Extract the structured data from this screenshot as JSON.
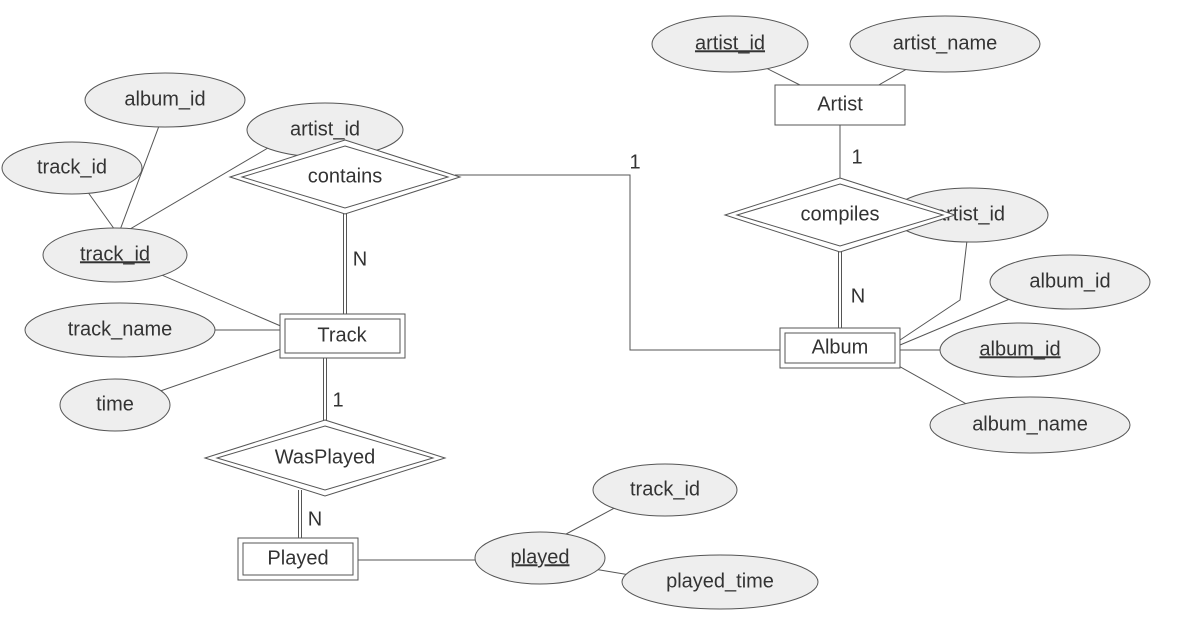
{
  "entities": {
    "artist": "Artist",
    "album": "Album",
    "track": "Track",
    "played": "Played"
  },
  "relationships": {
    "contains": "contains",
    "compiles": "compiles",
    "wasplayed": "WasPlayed"
  },
  "attributes": {
    "artist_artist_id": "artist_id",
    "artist_artist_name": "artist_name",
    "album_album_id": "album_id",
    "album_artist_id": "artist_id",
    "album_album_id_attr": "album_id",
    "album_album_name": "album_name",
    "track_track_id": "track_id",
    "track_track_id_sub": "track_id",
    "track_album_id_sub": "album_id",
    "track_artist_id_sub": "artist_id",
    "track_track_name": "track_name",
    "track_time": "time",
    "played_played": "played",
    "played_track_id": "track_id",
    "played_played_time": "played_time"
  },
  "cardinalities": {
    "contains_album": "1",
    "contains_track": "N",
    "compiles_artist": "1",
    "compiles_album": "N",
    "wasplayed_track": "1",
    "wasplayed_played": "N"
  }
}
